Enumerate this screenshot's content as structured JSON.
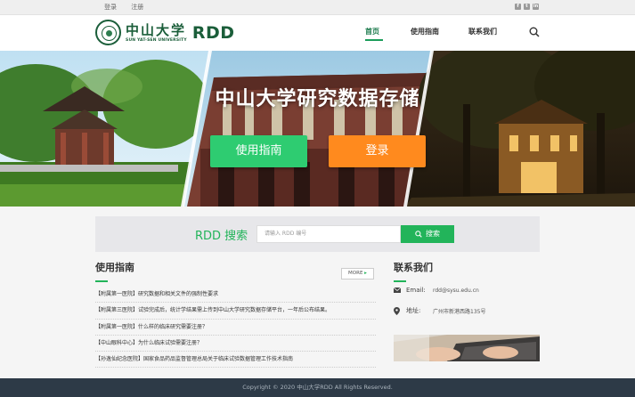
{
  "topbar": {
    "login": "登录",
    "register": "注册",
    "social": [
      "f",
      "t",
      "in"
    ]
  },
  "header": {
    "logo_cn": "中山大学",
    "logo_en": "SUN YAT-SEN UNIVERSITY",
    "logo_rdd": "RDD"
  },
  "nav": {
    "items": [
      "首页",
      "使用指南",
      "联系我们"
    ],
    "active": "首页"
  },
  "hero": {
    "title": "中山大学研究数据存储",
    "guide_button": "使用指南",
    "login_button": "登录"
  },
  "search": {
    "title": "RDD 搜索",
    "placeholder": "请输入 RDD 编号",
    "button": "搜索"
  },
  "guide": {
    "title": "使用指南",
    "more": "MORE",
    "items": [
      "【附属第一医院】研究数据和相关文件的强制性要求",
      "【附属第三医院】试验完成后，统计学结果需上传到中山大学研究数据存储平台，一年后公布结果。",
      "【附属第一医院】什么样的临床研究需要注册？",
      "【中山眼科中心】为什么临床试验需要注册？",
      "【孙逸仙纪念医院】国家食品药品监督管理总局关于临床试验数据管理工作技术指南"
    ]
  },
  "contact": {
    "title": "联系我们",
    "email_label": "Email:",
    "email": "rdd@sysu.edu.cn",
    "address_label": "地址:",
    "address": "广州市新港西路135号"
  },
  "footer": {
    "copyright": "Copyright © 2020 中山大学RDD All Rights Reserved."
  },
  "colors": {
    "brand_green": "#1b5e3a",
    "accent_green": "#22b45a",
    "orange": "#ff8a1e",
    "footer_bg": "#2d3a47"
  }
}
